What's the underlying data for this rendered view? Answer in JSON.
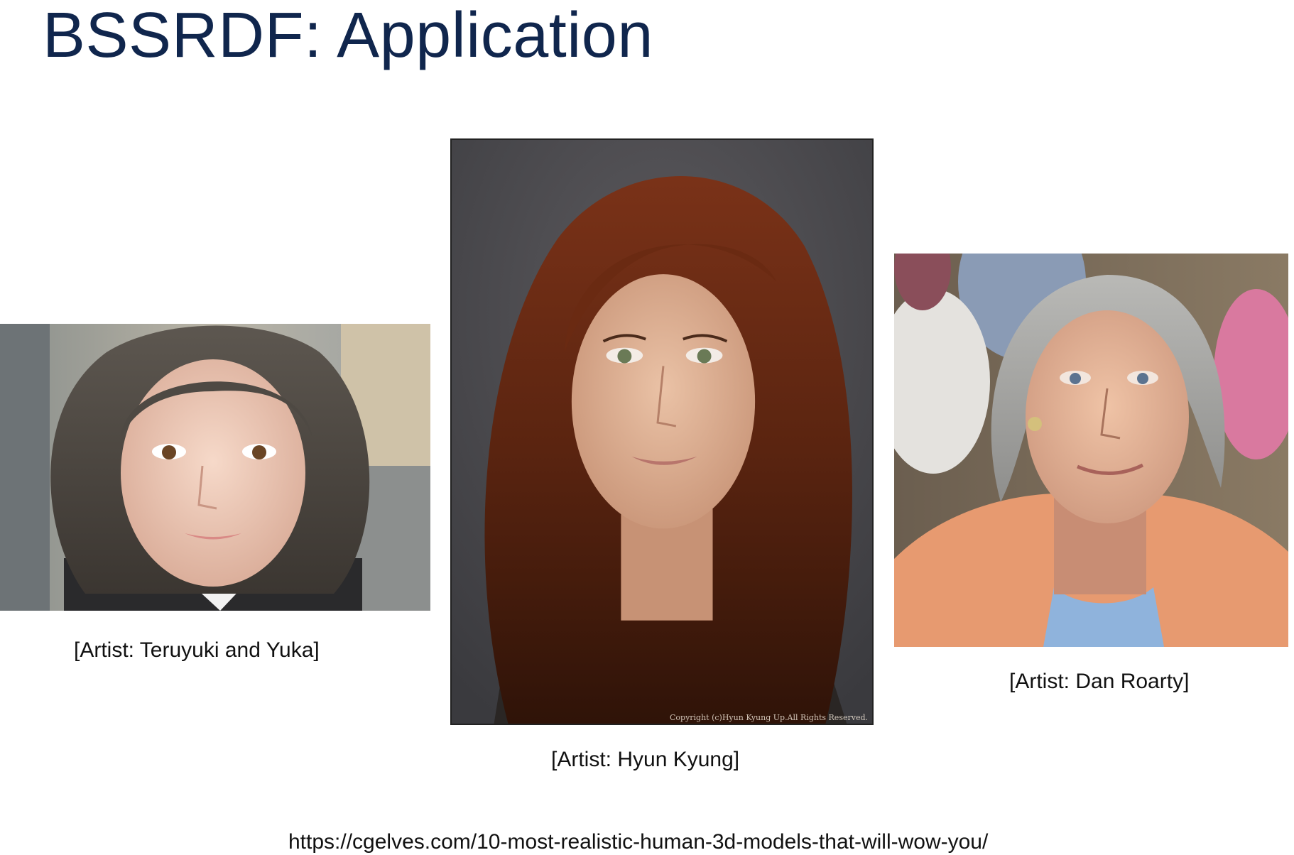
{
  "slide": {
    "title": "BSSRDF: Application"
  },
  "figures": [
    {
      "id": "left",
      "caption": "[Artist: Teruyuki and Yuka]",
      "image_description": "rendered portrait of young woman with bob haircut"
    },
    {
      "id": "center",
      "caption": "[Artist: Hyun Kyung]",
      "watermark": "Copyright (c)Hyun Kyung Up.All Rights Reserved.",
      "image_description": "rendered portrait of woman with long auburn hair"
    },
    {
      "id": "right",
      "caption": "[Artist: Dan Roarty]",
      "image_description": "rendered portrait of elderly woman with grey hair and balloons"
    }
  ],
  "source": {
    "url": "https://cgelves.com/10-most-realistic-human-3d-models-that-will-wow-you/"
  },
  "colors": {
    "title": "#10264d",
    "text": "#111111",
    "background": "#ffffff"
  }
}
